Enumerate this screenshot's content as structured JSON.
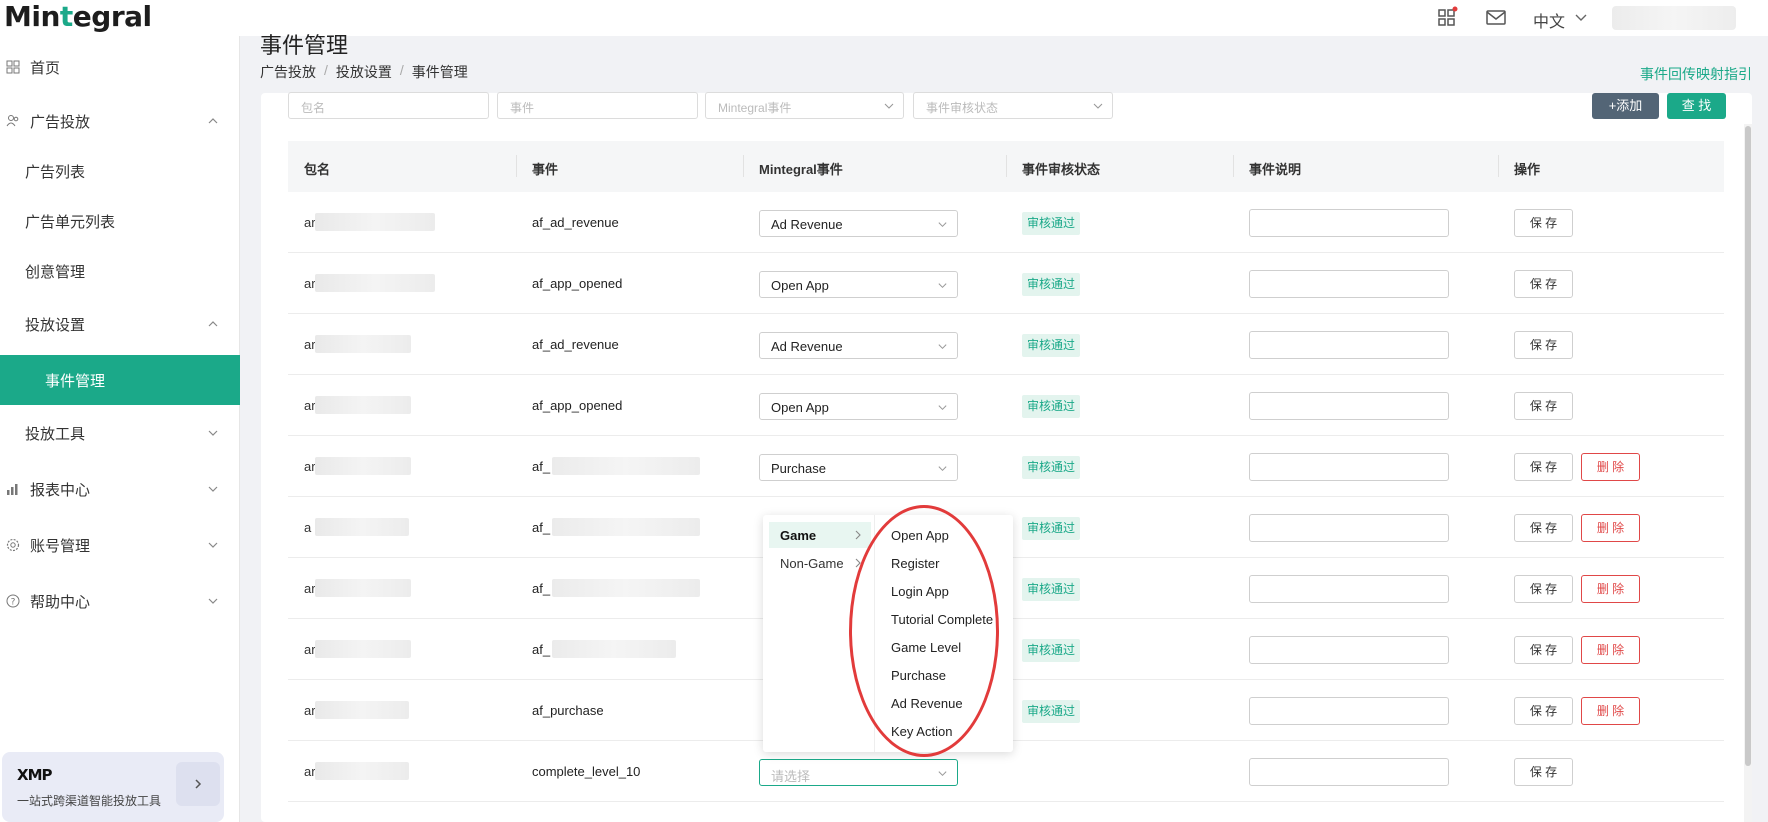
{
  "brand": {
    "logo_prefix": "Min",
    "logo_accent": "t",
    "logo_suffix": "egral"
  },
  "topbar": {
    "language": "中文"
  },
  "sidebar": {
    "items": [
      {
        "label": "首页"
      },
      {
        "label": "广告投放"
      },
      {
        "label": "广告列表"
      },
      {
        "label": "广告单元列表"
      },
      {
        "label": "创意管理"
      },
      {
        "label": "投放设置"
      },
      {
        "label": "事件管理"
      },
      {
        "label": "投放工具"
      },
      {
        "label": "报表中心"
      },
      {
        "label": "账号管理"
      },
      {
        "label": "帮助中心"
      }
    ],
    "xmp": {
      "logo": "XMP",
      "text": "一站式跨渠道智能投放工具"
    }
  },
  "page": {
    "title": "事件管理",
    "breadcrumb": [
      "广告投放",
      "投放设置",
      "事件管理"
    ],
    "guide_link": "事件回传映射指引"
  },
  "filters": {
    "package_placeholder": "包名",
    "event_placeholder": "事件",
    "mintegral_event_placeholder": "Mintegral事件",
    "status_placeholder": "事件审核状态",
    "add_label": "+添加",
    "search_label": "查 找"
  },
  "table": {
    "headers": [
      "包名",
      "事件",
      "Mintegral事件",
      "事件审核状态",
      "事件说明",
      "操作"
    ],
    "save_label": "保 存",
    "delete_label": "删 除",
    "select_placeholder": "请选择",
    "rows": [
      {
        "pkg": "ar",
        "event": "af_ad_revenue",
        "mintegral_event": "Ad Revenue",
        "status": "审核通过",
        "deletable": false
      },
      {
        "pkg": "ar",
        "event": "af_app_opened",
        "mintegral_event": "Open App",
        "status": "审核通过",
        "deletable": false
      },
      {
        "pkg": "ar",
        "event": "af_ad_revenue",
        "mintegral_event": "Ad Revenue",
        "status": "审核通过",
        "deletable": false
      },
      {
        "pkg": "ar",
        "event": "af_app_opened",
        "mintegral_event": "Open App",
        "status": "审核通过",
        "deletable": false
      },
      {
        "pkg": "ar",
        "event": "af_",
        "mintegral_event": "Purchase",
        "status": "审核通过",
        "deletable": true
      },
      {
        "pkg": "a",
        "event": "af_",
        "mintegral_event": "",
        "status": "审核通过",
        "deletable": true
      },
      {
        "pkg": "ar",
        "event": "af_",
        "mintegral_event": "",
        "status": "审核通过",
        "deletable": true
      },
      {
        "pkg": "ar",
        "event": "af_",
        "mintegral_event": "",
        "status": "审核通过",
        "deletable": true
      },
      {
        "pkg": "ar",
        "event": "af_purchase",
        "mintegral_event": "",
        "status": "审核通过",
        "deletable": true
      },
      {
        "pkg": "ar",
        "event": "complete_level_10",
        "mintegral_event": "",
        "status": "",
        "deletable": false
      }
    ]
  },
  "cascader": {
    "categories": [
      "Game",
      "Non-Game"
    ],
    "options": [
      "Open App",
      "Register",
      "Login App",
      "Tutorial Complete",
      "Game Level",
      "Purchase",
      "Ad Revenue",
      "Key Action"
    ]
  },
  "colors": {
    "accent": "#1ba989",
    "danger": "#e04848",
    "annotation": "#e23b3b",
    "dark_button": "#536576"
  }
}
